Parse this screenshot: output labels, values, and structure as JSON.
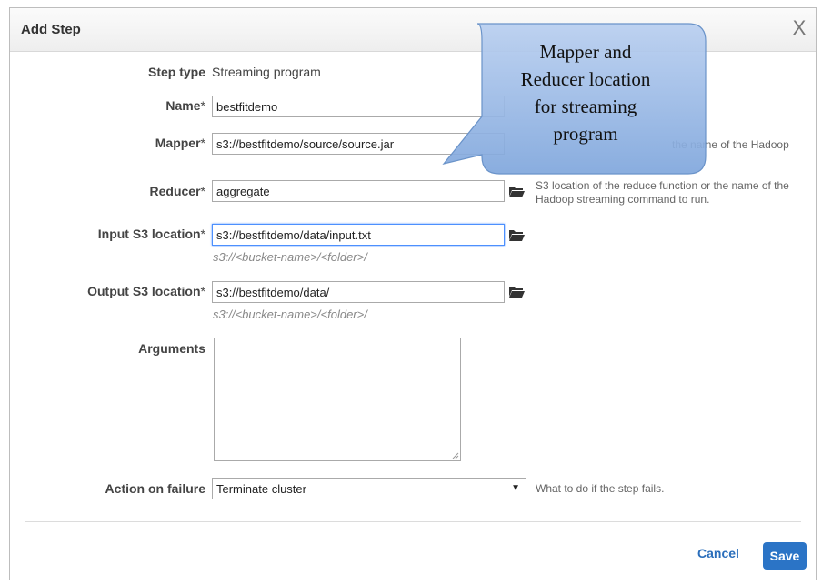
{
  "dialog": {
    "title": "Add Step",
    "close_glyph": "X"
  },
  "form": {
    "step_type": {
      "label": "Step type",
      "value": "Streaming program"
    },
    "name": {
      "label": "Name",
      "required_mark": "*",
      "value": "bestfitdemo"
    },
    "mapper": {
      "label": "Mapper",
      "required_mark": "*",
      "value": "s3://bestfitdemo/source/source.jar",
      "help_partial": "the name of the Hadoop"
    },
    "reducer": {
      "label": "Reducer",
      "required_mark": "*",
      "value": "aggregate",
      "help_line1": "S3 location of the reduce function or the name of the",
      "help_line2": "Hadoop streaming command to run."
    },
    "input": {
      "label": "Input S3 location",
      "required_mark": "*",
      "value": "s3://bestfitdemo/data/input.txt",
      "hint": "s3://<bucket-name>/<folder>/"
    },
    "output": {
      "label": "Output S3 location",
      "required_mark": "*",
      "value": "s3://bestfitdemo/data/",
      "hint": "s3://<bucket-name>/<folder>/"
    },
    "arguments": {
      "label": "Arguments",
      "value": ""
    },
    "action_on_failure": {
      "label": "Action on failure",
      "value": "Terminate cluster",
      "arrow": "▼",
      "help": "What to do if the step fails."
    }
  },
  "footer": {
    "cancel_label": "Cancel",
    "save_label": "Save"
  },
  "callout": {
    "line1": "Mapper and",
    "line2": "Reducer location",
    "line3": "for streaming",
    "line4": "program"
  },
  "colors": {
    "accent": "#2b74c6",
    "focus_border": "#4d90fe",
    "callout_fill": "#8eb4e3",
    "callout_stroke": "#6a93c9"
  },
  "icons": {
    "folder": "folder-open-icon",
    "close": "close-icon",
    "dropdown": "chevron-down-icon",
    "resize": "resize-grip-icon"
  }
}
